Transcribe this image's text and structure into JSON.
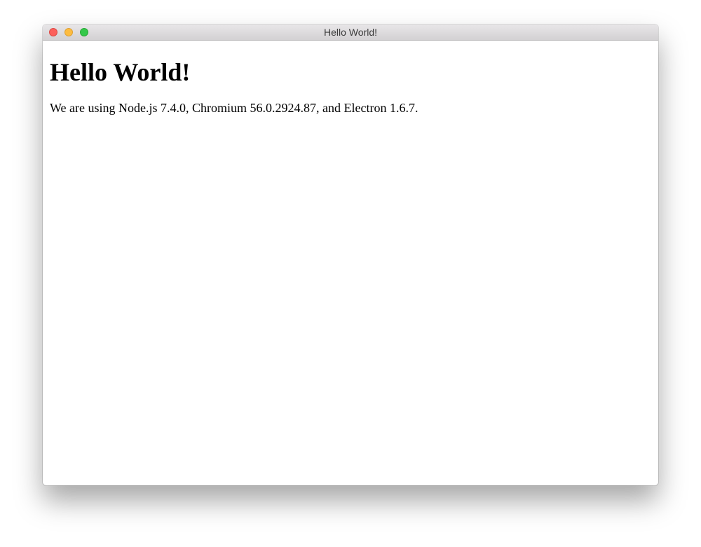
{
  "window": {
    "title": "Hello World!",
    "controls": {
      "close": "close-icon",
      "minimize": "minimize-icon",
      "zoom": "zoom-icon"
    },
    "colors": {
      "close": "#fc605c",
      "minimize": "#fdbc40",
      "zoom": "#34c84a"
    }
  },
  "page": {
    "heading": "Hello World!",
    "text": "We are using Node.js 7.4.0, Chromium 56.0.2924.87, and Electron 1.6.7."
  }
}
